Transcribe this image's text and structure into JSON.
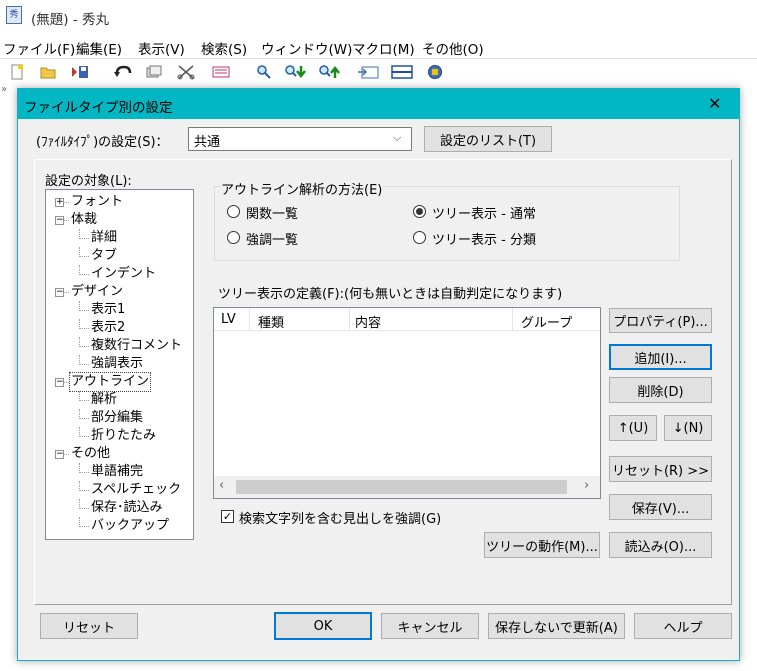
{
  "app": {
    "title": "(無題) - 秀丸",
    "menu": [
      "ファイル(F)",
      "編集(E)",
      "表示(V)",
      "検索(S)",
      "ウィンドウ(W)",
      "マクロ(M)",
      "その他(O)"
    ]
  },
  "dialog": {
    "title": "ファイルタイプ別の設定",
    "close_glyph": "✕",
    "filetype_label": "(ﾌｧｲﾙﾀｲﾌﾟ)の設定(S)：",
    "filetype_value": "共通",
    "settings_list_button": "設定のリスト(T)",
    "target_label": "設定の対象(L):",
    "tree": [
      {
        "label": "フォント",
        "level": 0,
        "expander": "+"
      },
      {
        "label": "体裁",
        "level": 0,
        "expander": "-"
      },
      {
        "label": "詳細",
        "level": 1
      },
      {
        "label": "タブ",
        "level": 1
      },
      {
        "label": "インデント",
        "level": 1
      },
      {
        "label": "デザイン",
        "level": 0,
        "expander": "-"
      },
      {
        "label": "表示1",
        "level": 1
      },
      {
        "label": "表示2",
        "level": 1
      },
      {
        "label": "複数行コメント",
        "level": 1
      },
      {
        "label": "強調表示",
        "level": 1
      },
      {
        "label": "アウトライン",
        "level": 0,
        "expander": "-",
        "selected": true
      },
      {
        "label": "解析",
        "level": 1
      },
      {
        "label": "部分編集",
        "level": 1
      },
      {
        "label": "折りたたみ",
        "level": 1
      },
      {
        "label": "その他",
        "level": 0,
        "expander": "-"
      },
      {
        "label": "単語補完",
        "level": 1
      },
      {
        "label": "スペルチェック",
        "level": 1
      },
      {
        "label": "保存･読込み",
        "level": 1
      },
      {
        "label": "バックアップ",
        "level": 1
      }
    ],
    "outline_group_label": "アウトライン解析の方法(E)",
    "radios": {
      "func_list": "関数一覧",
      "highlight_list": "強調一覧",
      "tree_normal": "ツリー表示 - 通常",
      "tree_category": "ツリー表示 - 分類",
      "selected": "tree_normal"
    },
    "tree_def_label": "ツリー表示の定義(F):(何も無いときは自動判定になります)",
    "columns": [
      "LV",
      "種類",
      "内容",
      "グループ"
    ],
    "checkbox_label": "検索文字列を含む見出しを強調(G)",
    "checkbox_checked": true,
    "side_buttons": {
      "property": "プロパティ(P)...",
      "add": "追加(I)...",
      "delete": "削除(D)",
      "up": "↑(U)",
      "down": "↓(N)",
      "reset": "リセット(R) >>",
      "save": "保存(V)...",
      "load": "読込み(O)..."
    },
    "tree_action_button": "ツリーの動作(M)...",
    "bottom": {
      "reset": "リセット",
      "ok": "OK",
      "cancel": "キャンセル",
      "update_no_save": "保存しないで更新(A)",
      "help": "ヘルプ"
    }
  }
}
